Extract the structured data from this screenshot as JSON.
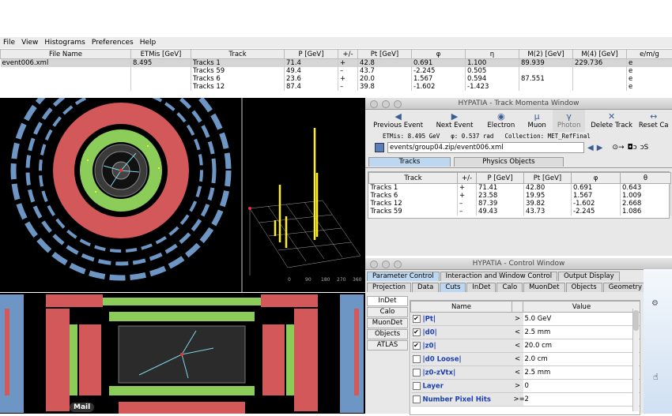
{
  "menu": [
    "File",
    "View",
    "Histograms",
    "Preferences",
    "Help"
  ],
  "main_table": {
    "columns": [
      "File Name",
      "ETMis [GeV]",
      "Track",
      "P [GeV]",
      "+/-",
      "Pt [GeV]",
      "φ",
      "η",
      "M(2) [GeV]",
      "M(4) [GeV]",
      "e/m/g"
    ],
    "rows": [
      [
        "event006.xml",
        "8.495",
        "Tracks 1",
        "71.4",
        "+",
        "42.8",
        "0.691",
        "1.100",
        "89.939",
        "229.736",
        "e"
      ],
      [
        "",
        "",
        "Tracks 59",
        "49.4",
        "–",
        "43.7",
        "-2.245",
        "0.505",
        "",
        "",
        "e"
      ],
      [
        "",
        "",
        "Tracks 6",
        "23.6",
        "+",
        "20.0",
        "1.567",
        "0.594",
        "87.551",
        "",
        "e"
      ],
      [
        "",
        "",
        "Tracks 12",
        "87.4",
        "–",
        "39.8",
        "-1.602",
        "-1.423",
        "",
        "",
        "e"
      ]
    ]
  },
  "lego_axis": [
    "0",
    "90",
    "180",
    "270",
    "360"
  ],
  "dock_label": "Mail",
  "track_window": {
    "title": "HYPATIA - Track Momenta Window",
    "toolbar": [
      {
        "label": "Previous Event",
        "icon": "◀"
      },
      {
        "label": "Next Event",
        "icon": "▶"
      },
      {
        "label": "Electron",
        "icon": "◉"
      },
      {
        "label": "Muon",
        "icon": "μ"
      },
      {
        "label": "Photon",
        "icon": "γ"
      },
      {
        "label": "Delete Track",
        "icon": "✕"
      },
      {
        "label": "Reset Ca",
        "icon": "↔"
      }
    ],
    "etmis": "ETMis: 8.495 GeV",
    "phi": "φ: 0.537 rad",
    "collection": "Collection: MET_RefFinal",
    "path": "events/group04.zip/event006.xml",
    "tabs": [
      "Tracks",
      "Physics Objects"
    ],
    "columns": [
      "Track",
      "+/-",
      "P [GeV]",
      "Pt [GeV]",
      "φ",
      "θ"
    ],
    "rows": [
      [
        "Tracks 1",
        "+",
        "71.41",
        "42.80",
        "0.691",
        "0.643"
      ],
      [
        "Tracks 6",
        "+",
        "23.58",
        "19.95",
        "1.567",
        "1.009"
      ],
      [
        "Tracks 12",
        "–",
        "87.39",
        "39.82",
        "-1.602",
        "2.668"
      ],
      [
        "Tracks 59",
        "–",
        "49.43",
        "43.73",
        "-2.245",
        "1.086"
      ]
    ]
  },
  "control_window": {
    "title": "HYPATIA - Control Window",
    "tabs": [
      "Parameter Control",
      "Interaction and Window Control",
      "Output Display"
    ],
    "subtabs": [
      "Projection",
      "Data",
      "Cuts",
      "InDet",
      "Calo",
      "MuonDet",
      "Objects",
      "Geometry"
    ],
    "side_tabs": [
      "InDet",
      "Calo",
      "MuonDet",
      "Objects",
      "ATLAS"
    ],
    "columns": [
      "Name",
      "Value"
    ],
    "cuts": [
      {
        "checked": true,
        "name": "|Pt|",
        "op": ">",
        "value": "5.0 GeV"
      },
      {
        "checked": true,
        "name": "|d0|",
        "op": "<",
        "value": "2.5 mm"
      },
      {
        "checked": true,
        "name": "|z0|",
        "op": "<",
        "value": "20.0 cm"
      },
      {
        "checked": false,
        "name": "|d0 Loose|",
        "op": "<",
        "value": "2.0 cm"
      },
      {
        "checked": false,
        "name": "|z0-zVtx|",
        "op": "<",
        "value": "2.5 mm"
      },
      {
        "checked": false,
        "name": "Layer",
        "op": ">",
        "value": "0"
      },
      {
        "checked": false,
        "name": "Number Pixel Hits",
        "op": ">=",
        "value": "2"
      }
    ]
  },
  "colors": {
    "calo_red": "#d2585a",
    "calo_green": "#8ccc58",
    "muon_blue": "#6e96c4",
    "track_cyan": "#7fd6e6",
    "tab_blue": "#bdd7f0"
  }
}
